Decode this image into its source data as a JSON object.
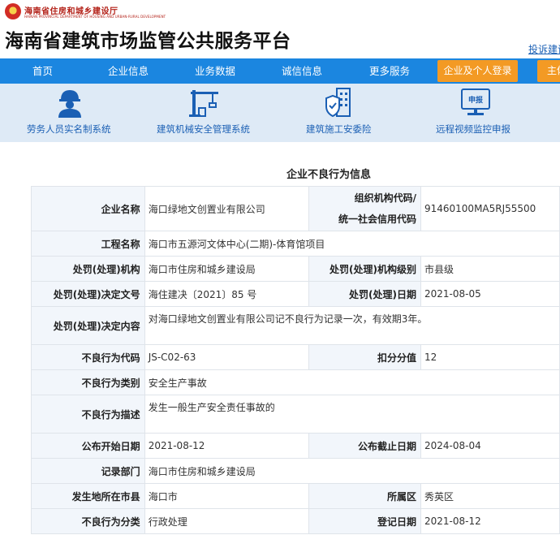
{
  "header": {
    "dept_name_cn": "海南省住房和城乡建设厅",
    "dept_name_en": "HAINAN PROVINCIAL DEPARTMENT OF HOUSING AND URBAN-RURAL DEVELOPMENT",
    "site_title": "海南省建筑市场监管公共服务平台",
    "complaint_link": "投诉建议"
  },
  "nav": {
    "items": [
      "首页",
      "企业信息",
      "业务数据",
      "诚信信息",
      "更多服务"
    ],
    "login_button": "企业及个人登录",
    "main_button": "主体"
  },
  "systems": {
    "items": [
      {
        "label": "劳务人员实名制系统",
        "icon": "worker-icon"
      },
      {
        "label": "建筑机械安全管理系统",
        "icon": "crane-icon"
      },
      {
        "label": "建筑施工安委险",
        "icon": "building-shield-icon"
      },
      {
        "label": "远程视频监控申报",
        "icon": "monitor-report-icon"
      }
    ],
    "report_icon_text": "申报"
  },
  "section_title": "企业不良行为信息",
  "record": {
    "company_label": "企业名称",
    "company_value": "海口绿地文创置业有限公司",
    "org_code_label_line1": "组织机构代码/",
    "org_code_label_line2": "统一社会信用代码",
    "org_code_value": "91460100MA5RJ55500",
    "project_label": "工程名称",
    "project_value": "海口市五源河文体中心(二期)-体育馆项目",
    "authority_label": "处罚(处理)机构",
    "authority_value": "海口市住房和城乡建设局",
    "authority_level_label": "处罚(处理)机构级别",
    "authority_level_value": "市县级",
    "decision_no_label": "处罚(处理)决定文号",
    "decision_no_value": "海住建决〔2021〕85 号",
    "decision_date_label": "处罚(处理)日期",
    "decision_date_value": "2021-08-05",
    "decision_content_label": "处罚(处理)决定内容",
    "decision_content_value": "对海口绿地文创置业有限公司记不良行为记录一次，有效期3年。",
    "behavior_code_label": "不良行为代码",
    "behavior_code_value": "JS-C02-63",
    "deduction_label": "扣分分值",
    "deduction_value": "12",
    "behavior_type_label": "不良行为类别",
    "behavior_type_value": "安全生产事故",
    "behavior_desc_label": "不良行为描述",
    "behavior_desc_value": "发生一般生产安全责任事故的",
    "publish_start_label": "公布开始日期",
    "publish_start_value": "2021-08-12",
    "publish_end_label": "公布截止日期",
    "publish_end_value": "2024-08-04",
    "record_dept_label": "记录部门",
    "record_dept_value": "海口市住房和城乡建设局",
    "city_label": "发生地所在市县",
    "city_value": "海口市",
    "district_label": "所属区",
    "district_value": "秀英区",
    "category_label": "不良行为分类",
    "category_value": "行政处理",
    "register_date_label": "登记日期",
    "register_date_value": "2021-08-12"
  },
  "colors": {
    "nav_bg": "#1b86e0",
    "login_button_bg": "#f39a24",
    "system_bar_bg": "#deeaf6",
    "link": "#1a5fb4",
    "label_bg": "#f2f6fb",
    "border": "#dfe4ea",
    "dept_red": "#b32017"
  }
}
